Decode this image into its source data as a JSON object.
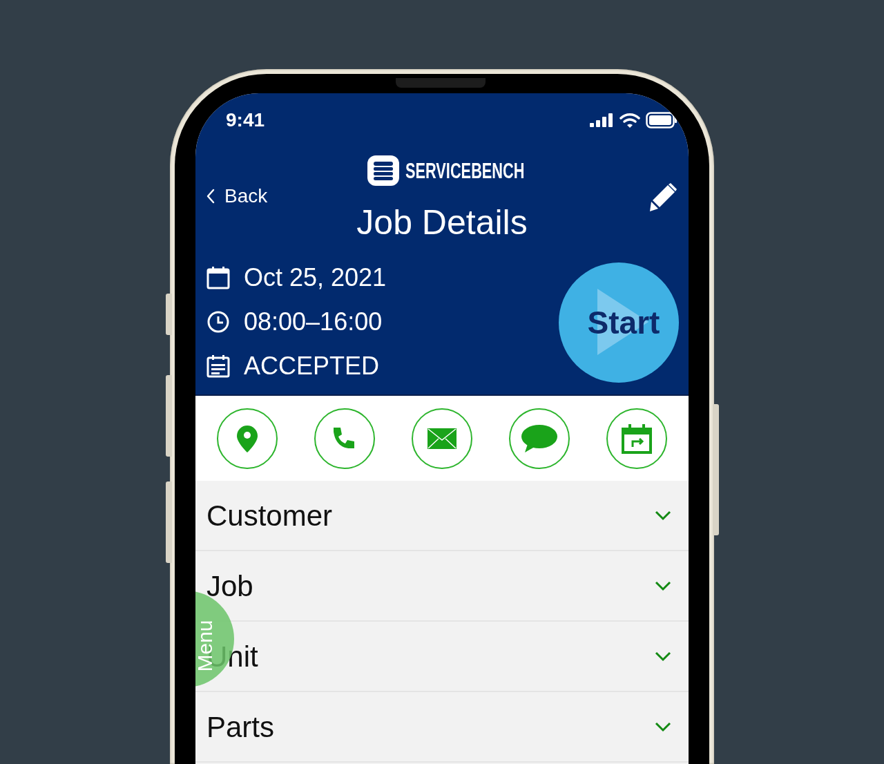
{
  "status_bar": {
    "time": "9:41"
  },
  "header": {
    "brand": "SERVICEBENCH",
    "back": "Back",
    "title": "Job Details"
  },
  "info": [
    {
      "kind": "date",
      "text": "Oct 25, 2021"
    },
    {
      "kind": "time",
      "text": "08:00–16:00"
    },
    {
      "kind": "status",
      "text": "ACCEPTED"
    }
  ],
  "start_button": {
    "label": "Start"
  },
  "actions": [
    {
      "kind": "location"
    },
    {
      "kind": "phone"
    },
    {
      "kind": "email"
    },
    {
      "kind": "chat"
    },
    {
      "kind": "reschedule"
    }
  ],
  "sections": [
    {
      "label": "Customer",
      "expanded": false
    },
    {
      "label": "Job",
      "expanded": false
    },
    {
      "label": "Unit",
      "expanded": false
    },
    {
      "label": "Parts",
      "expanded": false
    }
  ],
  "menu": {
    "label": "Menu"
  }
}
